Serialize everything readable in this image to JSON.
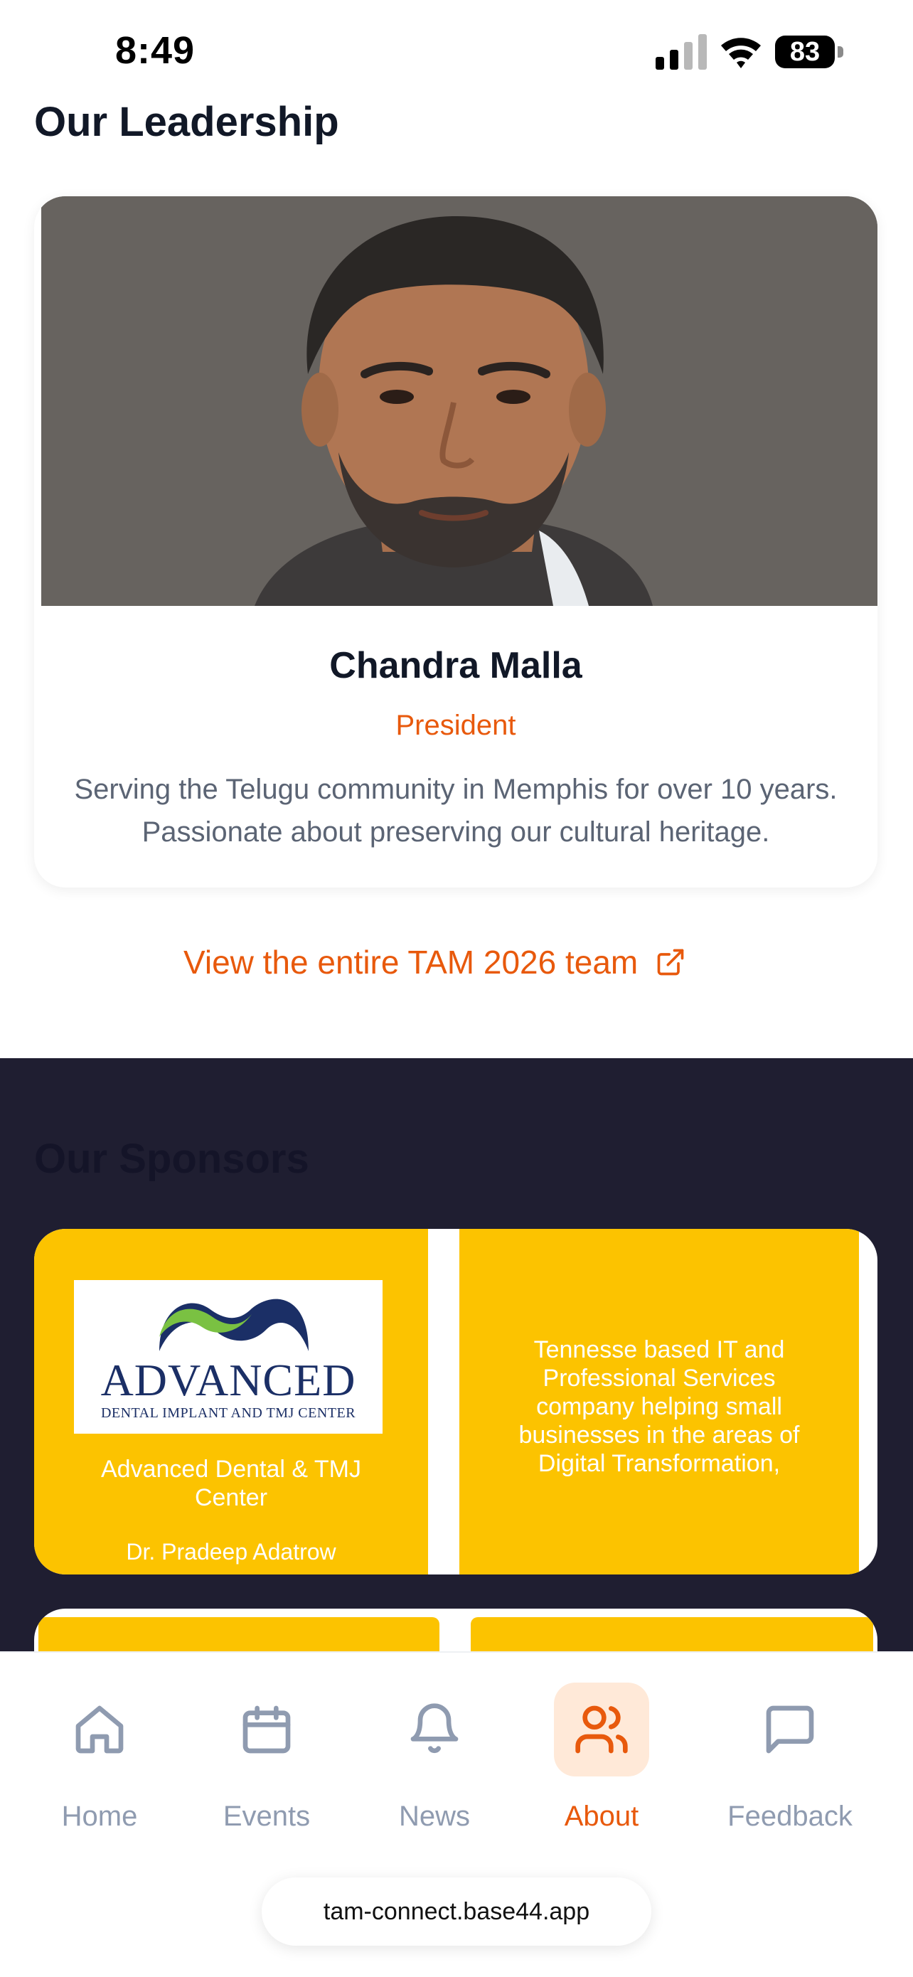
{
  "status_bar": {
    "time": "8:49",
    "battery": "83"
  },
  "leadership": {
    "title": "Our Leadership",
    "leader": {
      "name": "Chandra Malla",
      "role": "President",
      "bio": "Serving the Telugu community in Memphis for over 10 years. Passionate about preserving our cultural heritage."
    },
    "team_link": "View the entire TAM 2026 team"
  },
  "sponsors": {
    "title": "Our Sponsors",
    "items": [
      {
        "logo_word": "ADVANCED",
        "logo_sub": "DENTAL IMPLANT AND TMJ CENTER",
        "name": "Advanced Dental & TMJ Center",
        "person": "Dr. Pradeep Adatrow"
      },
      {
        "description": "Tennesse based IT and Professional Services company helping small businesses in the areas of Digital Transformation,"
      }
    ]
  },
  "tabs": [
    {
      "label": "Home",
      "icon": "home-icon"
    },
    {
      "label": "Events",
      "icon": "calendar-icon"
    },
    {
      "label": "News",
      "icon": "bell-icon"
    },
    {
      "label": "About",
      "icon": "users-icon",
      "active": true
    },
    {
      "label": "Feedback",
      "icon": "message-icon"
    }
  ],
  "browser": {
    "url": "tam-connect.base44.app"
  },
  "colors": {
    "accent": "#e8590c",
    "sponsor_card": "#fcc300",
    "sponsor_bg": "#1f1e31",
    "tab_inactive": "#8f9bb0"
  }
}
